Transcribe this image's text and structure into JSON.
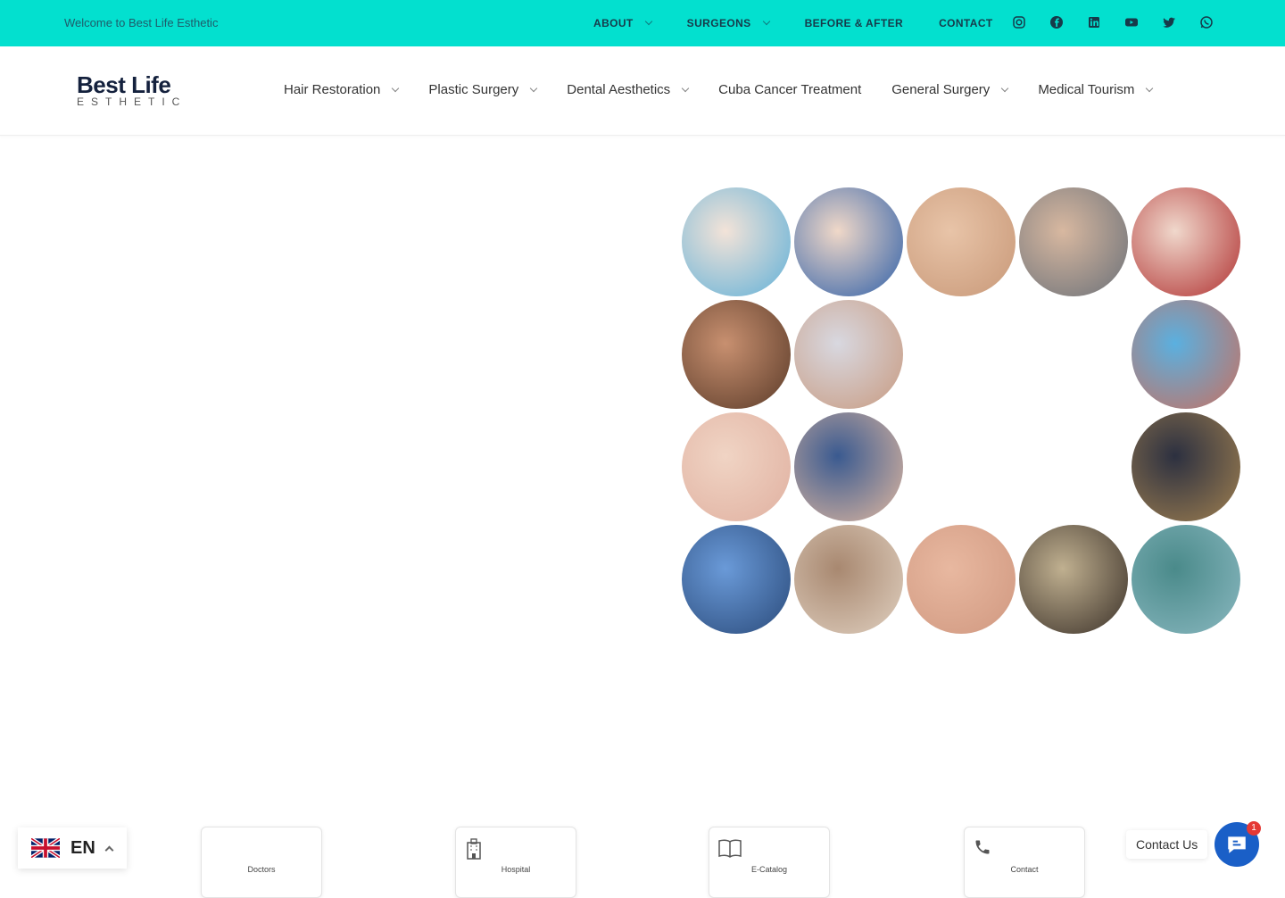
{
  "topbar": {
    "welcome": "Welcome to Best Life Esthetic",
    "nav": [
      {
        "label": "ABOUT",
        "dropdown": true
      },
      {
        "label": "SURGEONS",
        "dropdown": true
      },
      {
        "label": "BEFORE & AFTER",
        "dropdown": false
      },
      {
        "label": "CONTACT",
        "dropdown": false
      }
    ],
    "social": [
      "instagram-icon",
      "facebook-icon",
      "linkedin-icon",
      "youtube-icon",
      "twitter-icon",
      "whatsapp-icon"
    ],
    "color": "#03e0cf"
  },
  "logo": {
    "line1": "Best Life",
    "line2": "ESTHETIC"
  },
  "mainnav": [
    {
      "label": "Hair Restoration",
      "dropdown": true
    },
    {
      "label": "Plastic Surgery",
      "dropdown": true
    },
    {
      "label": "Dental Aesthetics",
      "dropdown": true
    },
    {
      "label": "Cuba Cancer Treatment",
      "dropdown": false
    },
    {
      "label": "General Surgery",
      "dropdown": true
    },
    {
      "label": "Medical Tourism",
      "dropdown": true
    }
  ],
  "gallery": [
    "face-treatment",
    "cancer-ribbon",
    "injection",
    "eye",
    "body-contour",
    "hair-transplant",
    "doctor-stethoscope",
    "",
    "",
    "dental-treatment",
    "tummy-tuck",
    "dental-patient",
    "",
    "",
    "hospital-building",
    "hospital-exterior",
    "hospital-room",
    "breast-surgery",
    "hotel-room",
    "surgeons"
  ],
  "cards": [
    {
      "label": "Doctors",
      "icon": ""
    },
    {
      "label": "Hospital",
      "icon": "hospital-icon"
    },
    {
      "label": "E-Catalog",
      "icon": "book-icon"
    },
    {
      "label": "Contact",
      "icon": "phone-icon"
    }
  ],
  "lang": {
    "code": "EN"
  },
  "chat": {
    "label": "Contact Us",
    "badge": "1"
  }
}
